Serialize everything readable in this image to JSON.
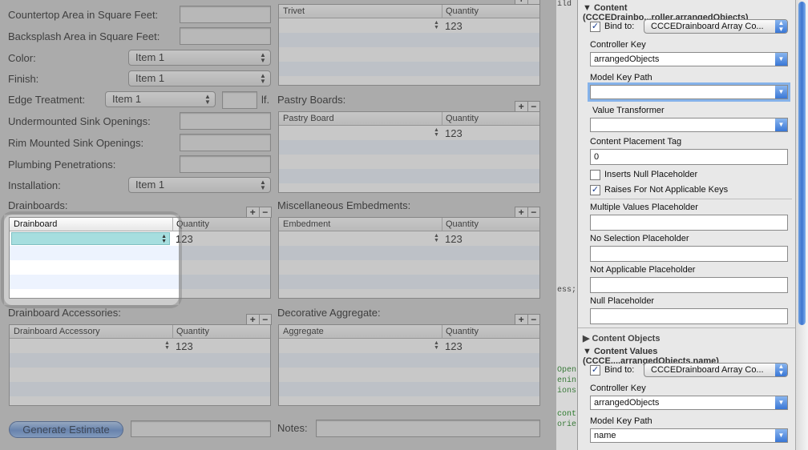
{
  "form": {
    "countertop_area": "Countertop Area in Square Feet:",
    "backsplash_area": "Backsplash Area in Square Feet:",
    "color": "Color:",
    "color_value": "Item 1",
    "finish": "Finish:",
    "finish_value": "Item 1",
    "edge_treatment": "Edge Treatment:",
    "edge_value": "Item 1",
    "edge_unit": "lf.",
    "undermounted": "Undermounted Sink Openings:",
    "rim_mounted": "Rim Mounted Sink Openings:",
    "plumbing": "Plumbing Penetrations:",
    "installation": "Installation:",
    "installation_value": "Item 1",
    "generate_button": "Generate Estimate",
    "notes": "Notes:"
  },
  "tables": {
    "trivet": {
      "col1": "Trivet",
      "col2": "Quantity",
      "qty": "123"
    },
    "pastry": {
      "title": "Pastry Boards:",
      "col1": "Pastry Board",
      "col2": "Quantity",
      "qty": "123"
    },
    "drainboards": {
      "title": "Drainboards:",
      "col1": "Drainboard",
      "col2": "Quantity",
      "qty": "123"
    },
    "embedments": {
      "title": "Miscellaneous Embedments:",
      "col1": "Embedment",
      "col2": "Quantity",
      "qty": "123"
    },
    "accessories": {
      "title": "Drainboard Accessories:",
      "col1": "Drainboard Accessory",
      "col2": "Quantity",
      "qty": "123"
    },
    "aggregate": {
      "title": "Decorative Aggregate:",
      "col1": "Aggregate",
      "col2": "Quantity",
      "qty": "123"
    }
  },
  "background_code": {
    "frag1": "ild",
    "frag2": "ess;",
    "frag3": "Open",
    "frag4": "enin",
    "frag5": "ions",
    "frag6": "cont",
    "frag7": "orie"
  },
  "inspector": {
    "content_header": "Content (CCCEDrainbo...roller.arrangedObjects)",
    "bind_to": "Bind to:",
    "bind_target": "CCCEDrainboard Array Co...",
    "controller_key": "Controller Key",
    "controller_value": "arrangedObjects",
    "model_key_path": "Model Key Path",
    "model_key_value": "",
    "value_transformer": "Value Transformer",
    "content_placement_tag": "Content Placement Tag",
    "content_placement_value": "0",
    "inserts_null": "Inserts Null Placeholder",
    "raises_not_applicable": "Raises For Not Applicable Keys",
    "multiple_values": "Multiple Values Placeholder",
    "no_selection": "No Selection Placeholder",
    "not_applicable": "Not Applicable Placeholder",
    "null_placeholder": "Null Placeholder",
    "content_objects": "Content Objects",
    "content_values_header": "Content Values (CCCE....arrangedObjects.name)",
    "bind_to2": "Bind to:",
    "bind_target2": "CCCEDrainboard Array Co...",
    "controller_key2": "Controller Key",
    "controller_value2": "arrangedObjects",
    "model_key_path2": "Model Key Path",
    "model_key_value2": "name"
  }
}
